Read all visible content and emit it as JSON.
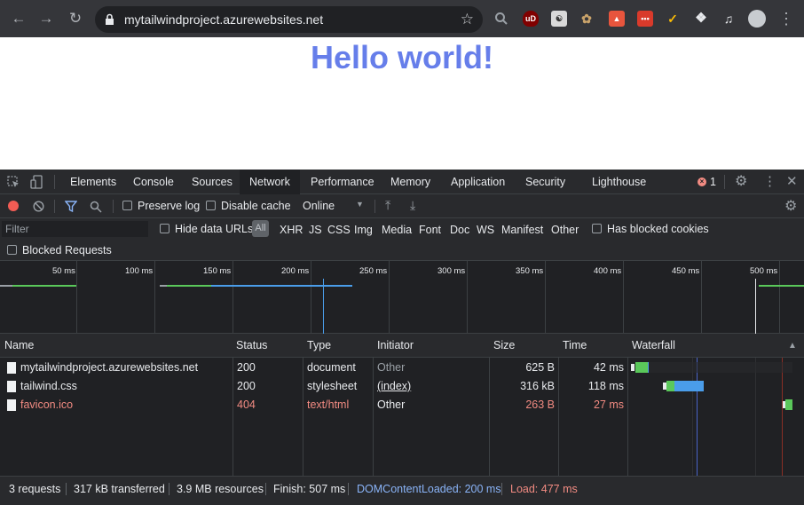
{
  "browser": {
    "url": "mytailwindproject.azurewebsites.net"
  },
  "page": {
    "heading": "Hello world!"
  },
  "devtools": {
    "tabs": [
      "Elements",
      "Console",
      "Sources",
      "Network",
      "Performance",
      "Memory",
      "Application",
      "Security",
      "Lighthouse"
    ],
    "active_tab": "Network",
    "error_count": "1",
    "toolbar": {
      "preserve_log": "Preserve log",
      "disable_cache": "Disable cache",
      "throttling": "Online"
    },
    "filter": {
      "placeholder": "Filter",
      "hide_data_urls": "Hide data URLs",
      "all": "All",
      "types": [
        "XHR",
        "JS",
        "CSS",
        "Img",
        "Media",
        "Font",
        "Doc",
        "WS",
        "Manifest",
        "Other"
      ],
      "has_blocked_cookies": "Has blocked cookies",
      "blocked_requests": "Blocked Requests"
    },
    "overview_ticks": [
      "50 ms",
      "100 ms",
      "150 ms",
      "200 ms",
      "250 ms",
      "300 ms",
      "350 ms",
      "400 ms",
      "450 ms",
      "500 ms"
    ],
    "columns": {
      "name": "Name",
      "status": "Status",
      "type": "Type",
      "initiator": "Initiator",
      "size": "Size",
      "time": "Time",
      "waterfall": "Waterfall"
    },
    "requests": [
      {
        "name": "mytailwindproject.azurewebsites.net",
        "status": "200",
        "type": "document",
        "initiator": "Other",
        "size": "625 B",
        "time": "42 ms"
      },
      {
        "name": "tailwind.css",
        "status": "200",
        "type": "stylesheet",
        "initiator": "(index)",
        "size": "316 kB",
        "time": "118 ms"
      },
      {
        "name": "favicon.ico",
        "status": "404",
        "type": "text/html",
        "initiator": "Other",
        "size": "263 B",
        "time": "27 ms"
      }
    ],
    "status": {
      "requests": "3 requests",
      "transferred": "317 kB transferred",
      "resources": "3.9 MB resources",
      "finish": "Finish: 507 ms",
      "dom_content_loaded": "DOMContentLoaded: 200 ms",
      "load": "Load: 477 ms"
    }
  },
  "colors": {
    "heading": "#667eea",
    "error_row": "#f28b82",
    "dcl": "#8ab4f8",
    "waiting": "#5ac85a",
    "download": "#4a9dea"
  }
}
